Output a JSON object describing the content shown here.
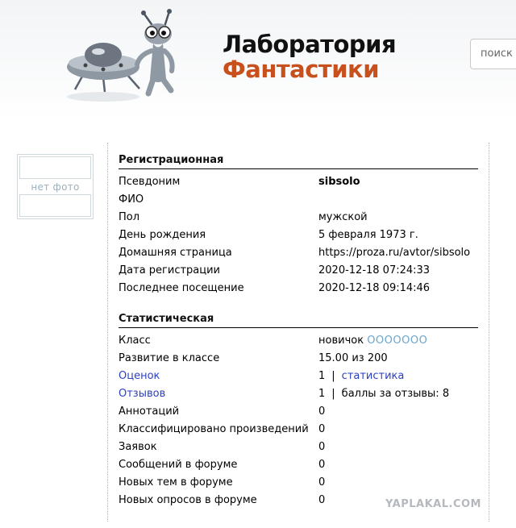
{
  "header": {
    "title_line1": "Лаборатория",
    "title_line2": "Фантастики",
    "search_placeholder": "поиск"
  },
  "profile": {
    "photo_label": "нет фото"
  },
  "registration": {
    "title": "Регистрационная",
    "rows": [
      {
        "label": "Псевдоним",
        "value": "sibsolo"
      },
      {
        "label": "ФИО",
        "value": ""
      },
      {
        "label": "Пол",
        "value": "мужской"
      },
      {
        "label": "День рождения",
        "value": "5 февраля 1973 г."
      },
      {
        "label": "Домашняя страница",
        "value": "https://proza.ru/avtor/sibsolo"
      },
      {
        "label": "Дата регистрации",
        "value": "2020-12-18 07:24:33"
      },
      {
        "label": "Последнее посещение",
        "value": "2020-12-18 09:14:46"
      }
    ]
  },
  "stats": {
    "title": "Статистическая",
    "class_label": "Класс",
    "class_value": "новичок",
    "class_dots": "OOOOOOO",
    "development_label": "Развитие в классе",
    "development_value": "15.00 из 200",
    "ratings_label": "Оценок",
    "ratings_count": "1",
    "ratings_link": "статистика",
    "reviews_label": "Отзывов",
    "reviews_count": "1",
    "reviews_extra": "баллы за отзывы: 8",
    "separator": "|",
    "rows": [
      {
        "label": "Аннотаций",
        "value": "0"
      },
      {
        "label": "Классифицировано произведений",
        "value": "0"
      },
      {
        "label": "Заявок",
        "value": "0"
      },
      {
        "label": "Сообщений в форуме",
        "value": "0"
      },
      {
        "label": "Новых тем в форуме",
        "value": "0"
      },
      {
        "label": "Новых опросов в форуме",
        "value": "0"
      }
    ]
  },
  "watermark": "YAPLAKAL.COM"
}
